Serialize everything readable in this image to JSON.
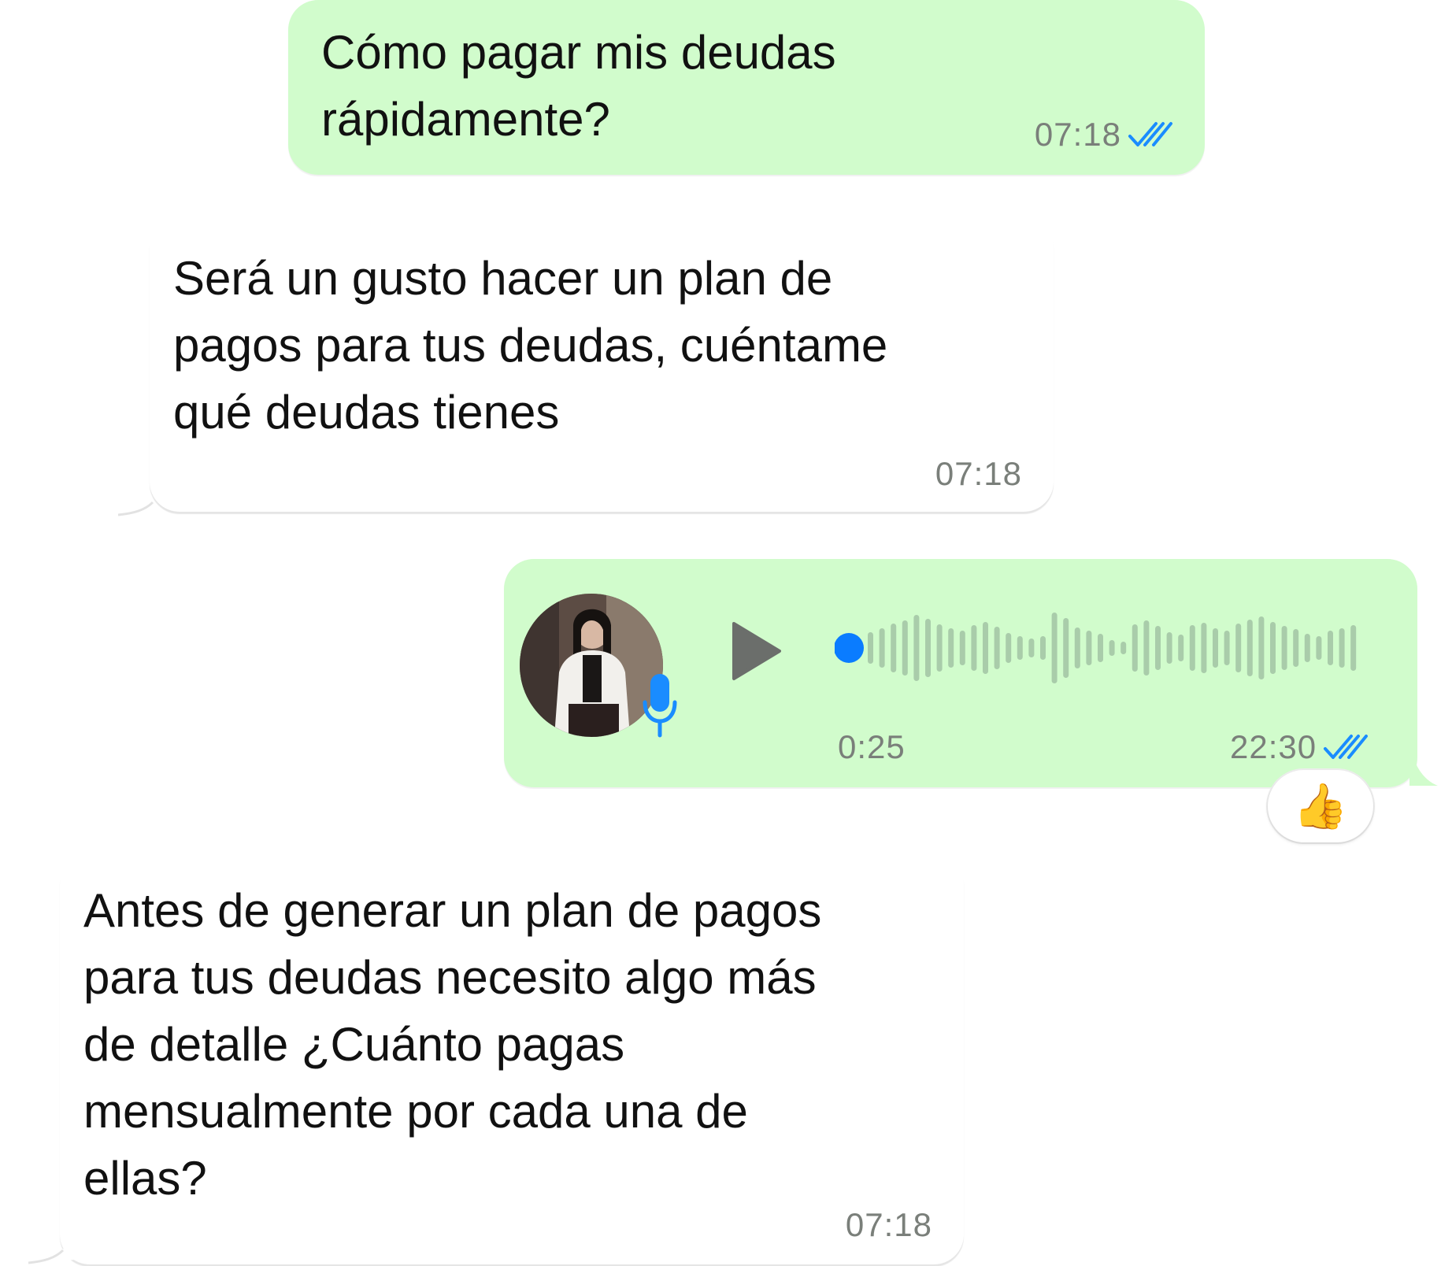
{
  "messages": [
    {
      "id": "m1",
      "direction": "outgoing",
      "text": "Cómo pagar mis deudas\nrápidamente?",
      "time": "07:18",
      "status": "read"
    },
    {
      "id": "m2",
      "direction": "incoming",
      "text": "Será un gusto hacer un plan de\npagos para tus deudas, cuéntame\nqué deudas tienes",
      "time": "07:18"
    },
    {
      "id": "m3",
      "direction": "outgoing",
      "type": "voice",
      "duration": "0:25",
      "time": "22:30",
      "status": "read",
      "playback_progress": 0,
      "reaction": "👍"
    },
    {
      "id": "m4",
      "direction": "incoming",
      "text": "Antes de generar un plan de pagos\npara tus deudas necesito algo más\nde detalle ¿Cuánto pagas\nmensualmente por cada una de\nellas?",
      "time": "07:18"
    }
  ],
  "colors": {
    "outgoing_bubble": "#d1fccc",
    "incoming_bubble": "#ffffff",
    "read_ticks": "#1a8cff",
    "waveform": "#a9ccaa",
    "progress_dot": "#0a7cff",
    "play_icon": "#6b6e6b",
    "timestamp": "#7a7f7a"
  },
  "icons": [
    "double-check-icon",
    "play-icon",
    "microphone-icon",
    "thumbs-up-emoji"
  ]
}
